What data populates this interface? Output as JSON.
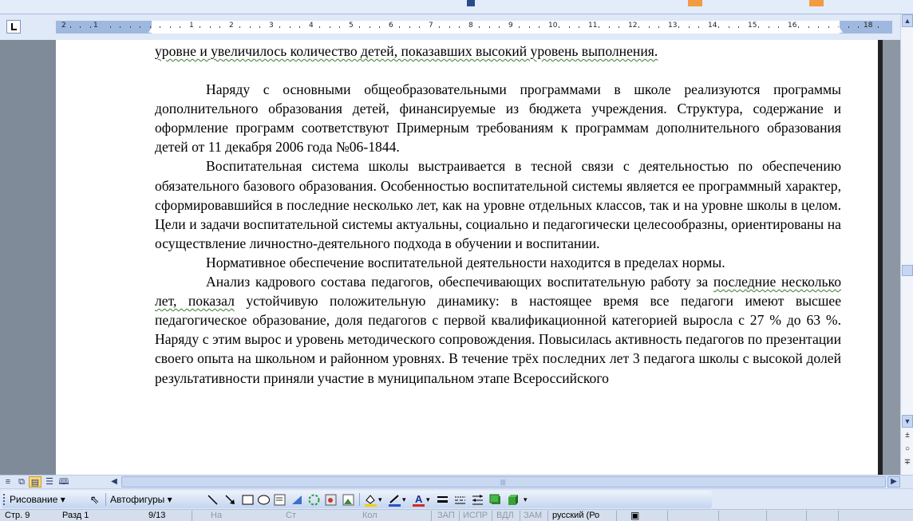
{
  "ruler": {
    "numbers": [
      "2",
      "1",
      "1",
      "2",
      "3",
      "4",
      "5",
      "6",
      "7",
      "8",
      "9",
      "10",
      "11",
      "12",
      "13",
      "14",
      "15",
      "16",
      "18"
    ]
  },
  "document": {
    "line_top": "уровне и увеличилось количество детей, показавших высокий уровень выполнения.",
    "para1": "Наряду с основными общеобразовательными программами в школе реализуются программы дополнительного образования детей, финансируемые из бюджета учреждения. Структура, содержание и оформление программ соответствуют Примерным требованиям к программам дополнительного образования детей от 11 декабря 2006 года №06-1844.",
    "para2": "Воспитательная система школы выстраивается в тесной связи с деятельностью по обеспечению обязательного базового образования. Особенностью воспитательной системы является ее программный характер, сформировавшийся в последние несколько лет, как на уровне отдельных классов, так и на уровне школы в целом. Цели и задачи воспитательной системы актуальны, социально и педагогически целесообразны, ориентированы на осуществление личностно-деятельного подхода в обучении и воспитании.",
    "para3": "Нормативное обеспечение воспитательной деятельности находится в пределах нормы.",
    "para4_a": "Анализ кадрового состава педагогов, обеспечивающих воспитательную работу за",
    "para4_b_squig": "последние несколько лет, показал",
    "para4_c": " устойчивую положительную динамику: в настоящее время все педагоги имеют высшее педагогическое образование, доля педагогов с первой квалификационной категорией выросла с 27 % до 63 %. Наряду с этим вырос и уровень методического сопровождения. Повысилась активность педагогов по презентации своего опыта на школьном и районном уровнях. В течение трёх последних лет 3 педагога школы с высокой долей результативности приняли участие в муниципальном этапе Всероссийского"
  },
  "drawbar": {
    "drawing_label": "Рисование",
    "autoshapes_label": "Автофигуры"
  },
  "statusbar": {
    "page": "Стр. 9",
    "section": "Разд 1",
    "pages": "9/13",
    "at": "На",
    "line": "Ст",
    "col": "Кол",
    "rec": "ЗАП",
    "trk": "ИСПР",
    "ext": "ВДЛ",
    "ovr": "ЗАМ",
    "language": "русский (Ро"
  },
  "colors": {
    "accent": "#fdd87f",
    "toolbar": "#dfe8f6",
    "status": "#d4deed",
    "spellcheck": "#3a7d2c"
  }
}
